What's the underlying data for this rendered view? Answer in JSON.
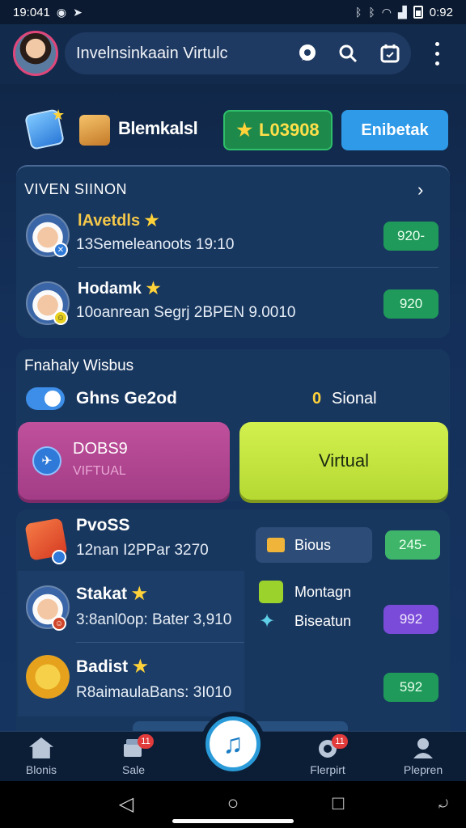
{
  "status_bar": {
    "time": "19:041",
    "right_time": "0:92",
    "icons": [
      "whatsapp-icon",
      "telegram-icon",
      "bluetooth-icon",
      "wifi-icon",
      "signal-icon",
      "battery-icon"
    ]
  },
  "header": {
    "search_text": "Invelnsinkaain Virtulc",
    "actions": [
      "chat-icon",
      "search-icon",
      "calendar-icon",
      "more-vert-icon"
    ]
  },
  "quick_row": {
    "label": "Blemkalsl",
    "coin_value": "L03908",
    "action_button": "Enibetak"
  },
  "section_one": {
    "title": "VIVEN SIINON",
    "rows": [
      {
        "name": "lAvetdls",
        "subtitle": "13Semeleanoots 19:10",
        "value": "920-"
      },
      {
        "name": "Hodamk",
        "subtitle": "10oanrean Segrj 2BPEN 9.0010",
        "value": "920"
      }
    ]
  },
  "section_two": {
    "title": "Fnahaly Wisbus",
    "option_one": "Ghns Ge2od",
    "coin_glyph": "0",
    "option_two": "Sional",
    "card_pink": {
      "title": "DOBS9",
      "subtitle": "VIFTUAL"
    },
    "card_lime": {
      "title": "Virtual"
    }
  },
  "section_three": {
    "rows": [
      {
        "name": "PvoSS",
        "subtitle": "12nan I2PPar 3270"
      },
      {
        "name": "Stakat",
        "subtitle": "3:8anl0op: Bater 3,910"
      },
      {
        "name": "Badist",
        "subtitle": "R8aimaulaBans: 3I010"
      }
    ],
    "chip_label": "Bious",
    "pill_top": "245-",
    "option_a": "Montagn",
    "option_b": "Biseatun",
    "pill_mid": "992",
    "pill_bottom": "592"
  },
  "bottom_nav": {
    "items": [
      {
        "label": "Blonis",
        "icon": "home-icon"
      },
      {
        "label": "Sale",
        "icon": "store-icon",
        "badge": "11"
      },
      {
        "label": "Flerpirt",
        "icon": "target-icon",
        "badge": "11"
      },
      {
        "label": "Plepren",
        "icon": "profile-icon"
      }
    ],
    "center_icon": "music-note-icon"
  },
  "colors": {
    "accent_blue": "#2f9ae8",
    "green_pill": "#1f9a5a",
    "pink_card": "#c0519c",
    "lime_card": "#d2f04e",
    "background": "#14305a"
  }
}
